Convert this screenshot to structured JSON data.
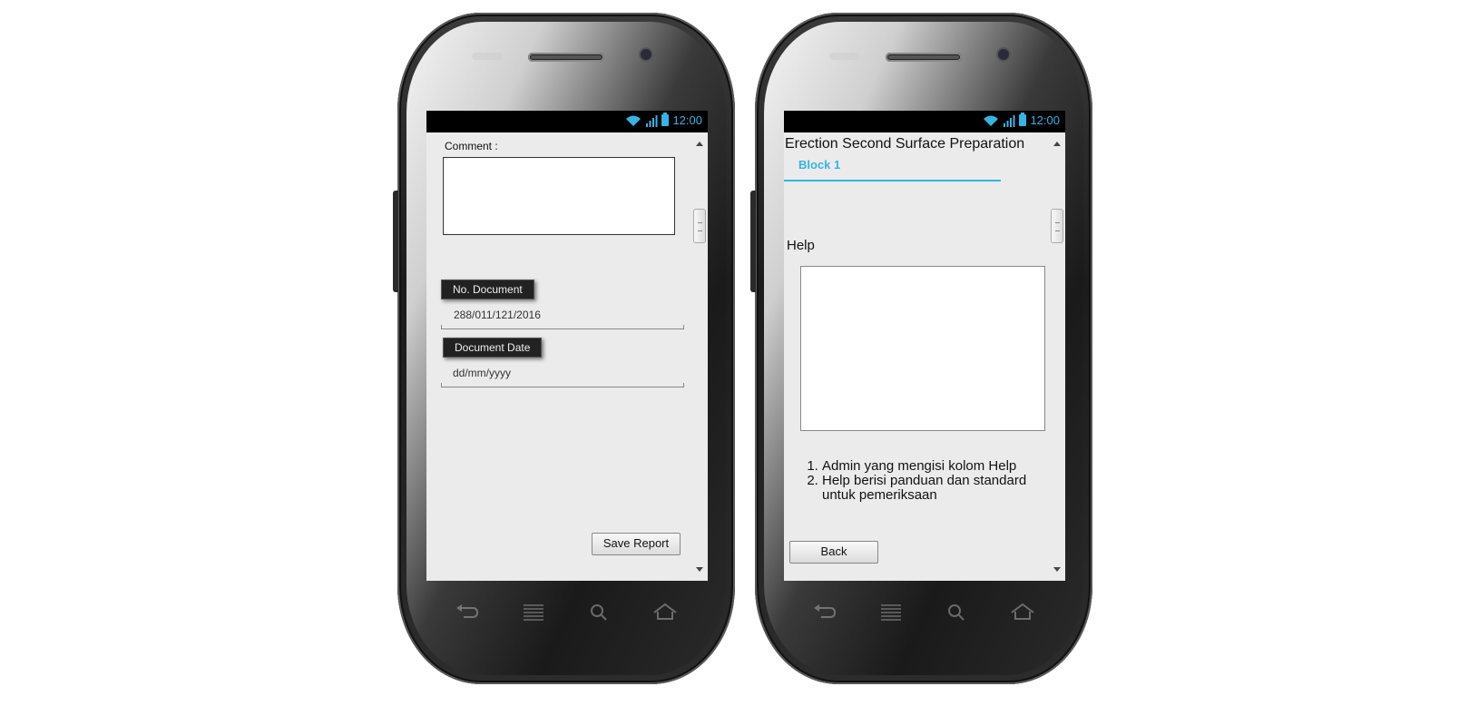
{
  "status_bar": {
    "time": "12:00"
  },
  "left_screen": {
    "comment_label": "Comment :",
    "no_document_label": "No. Document",
    "no_document_value": "288/011/121/2016",
    "document_date_label": "Document Date",
    "document_date_placeholder": "dd/mm/yyyy",
    "save_button": "Save Report"
  },
  "right_screen": {
    "title": "Erection Second Surface Preparation",
    "tab": "Block 1",
    "help_label": "Help",
    "help_notes": [
      "Admin yang mengisi kolom Help",
      "Help berisi panduan dan standard untuk pemeriksaan"
    ],
    "back_button": "Back"
  },
  "colors": {
    "accent": "#33b5e5",
    "status_bar": "#000000",
    "screen_bg": "#ebebeb"
  },
  "nav_icons": [
    "back-icon",
    "menu-icon",
    "search-icon",
    "home-icon"
  ]
}
